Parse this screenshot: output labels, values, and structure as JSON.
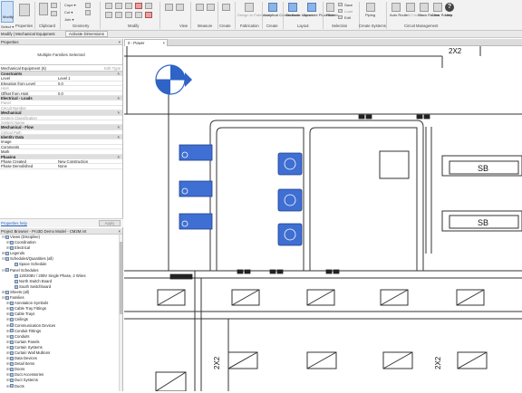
{
  "ribbon": {
    "modify_label": "Modify",
    "select_label": "Select ▾",
    "properties_panel": "Properties",
    "clipboard_panel": "Clipboard",
    "geometry_panel": "Geometry",
    "modify_panel": "Modify",
    "view_panel": "View",
    "measure_panel": "Measure",
    "create_panel": "Create",
    "fabrication_panel": "Fabrication",
    "layout_panel": "Layout",
    "selection_panel": "Selection",
    "create_systems_panel": "Create Systems",
    "circuit_panel": "Circuit Management",
    "cope_label": "Cope ▾",
    "cut_label": "Cut ▾",
    "join_label": "Join ▾",
    "tools": {
      "design_to_fabrication": "Design to Fabrication",
      "analytical_connections": "Analytical Connections",
      "generate_layout": "Generate Layout",
      "generate_placeholder": "Generate Placeholder",
      "filter": "Filter",
      "save": "Save",
      "load": "Load",
      "edit": "Edit",
      "piping": "Piping",
      "auto_route": "Auto Route",
      "edit_circuits": "Edit Circuits",
      "show_routes": "Show Routes",
      "clear_routes": "Clear Routes",
      "help": "Help"
    }
  },
  "context": {
    "title": "Modify | Mechanical Equipment",
    "activate_dimensions": "Activate Dimensions"
  },
  "properties": {
    "title": "Properties",
    "type_selector": "Multiple Families Selected",
    "filter": "Mechanical Equipment (6)",
    "edit_type": "Edit Type",
    "rows": [
      {
        "k": "Constraints",
        "group": true
      },
      {
        "k": "Level",
        "v": "Level 1"
      },
      {
        "k": "Elevation from Level",
        "v": "0.0"
      },
      {
        "k": "Host",
        "v": "",
        "grey": true
      },
      {
        "k": "Offset from Host",
        "v": "0.0"
      },
      {
        "k": "Electrical - Loads",
        "group": true
      },
      {
        "k": "Panel",
        "v": "",
        "grey": true
      },
      {
        "k": "Circuit Number",
        "v": "",
        "grey": true
      },
      {
        "k": "Mechanical",
        "group": true
      },
      {
        "k": "System Classification",
        "v": "",
        "grey": true
      },
      {
        "k": "System Name",
        "v": "",
        "grey": true
      },
      {
        "k": "Mechanical - Flow",
        "group": true
      },
      {
        "k": "Critical Path",
        "v": "",
        "grey": true
      },
      {
        "k": "Identity Data",
        "group": true
      },
      {
        "k": "Image",
        "v": ""
      },
      {
        "k": "Comments",
        "v": ""
      },
      {
        "k": "Mark",
        "v": ""
      },
      {
        "k": "Phasing",
        "group": true
      },
      {
        "k": "Phase Created",
        "v": "New Construction"
      },
      {
        "k": "Phase Demolished",
        "v": "None"
      }
    ],
    "help_link": "Properties help",
    "apply": "Apply"
  },
  "browser": {
    "title": "Project Browser - Pro3D Demo Model - CM2M.rvt",
    "items": [
      {
        "ex": "⊟",
        "label": "Views (Discipline)",
        "indent": 0
      },
      {
        "ex": "⊞",
        "label": "Coordination",
        "indent": 1
      },
      {
        "ex": "⊞",
        "label": "Electrical",
        "indent": 1
      },
      {
        "ex": "⊞",
        "label": "Legends",
        "indent": 0
      },
      {
        "ex": "⊟",
        "label": "Schedules/Quantities (all)",
        "indent": 0
      },
      {
        "ex": "",
        "label": "Space Schedule",
        "indent": 2
      },
      {
        "ex": "⊟",
        "label": "Panel Schedules",
        "indent": 0
      },
      {
        "ex": "",
        "label": "120/208V / 208V Single Phase, 2 Wires",
        "indent": 2
      },
      {
        "ex": "",
        "label": "North Switch Board",
        "indent": 2
      },
      {
        "ex": "",
        "label": "South Switchboard",
        "indent": 2
      },
      {
        "ex": "⊞",
        "label": "Sheets (all)",
        "indent": 0
      },
      {
        "ex": "⊟",
        "label": "Families",
        "indent": 0
      },
      {
        "ex": "⊞",
        "label": "Annotation Symbols",
        "indent": 1
      },
      {
        "ex": "⊞",
        "label": "Cable Tray Fittings",
        "indent": 1
      },
      {
        "ex": "⊞",
        "label": "Cable Trays",
        "indent": 1
      },
      {
        "ex": "⊞",
        "label": "Ceilings",
        "indent": 1
      },
      {
        "ex": "⊞",
        "label": "Communication Devices",
        "indent": 1
      },
      {
        "ex": "⊞",
        "label": "Conduit Fittings",
        "indent": 1
      },
      {
        "ex": "⊞",
        "label": "Conduits",
        "indent": 1
      },
      {
        "ex": "⊞",
        "label": "Curtain Panels",
        "indent": 1
      },
      {
        "ex": "⊞",
        "label": "Curtain Systems",
        "indent": 1
      },
      {
        "ex": "⊞",
        "label": "Curtain Wall Mullions",
        "indent": 1
      },
      {
        "ex": "⊞",
        "label": "Data Devices",
        "indent": 1
      },
      {
        "ex": "⊞",
        "label": "Detail Items",
        "indent": 1
      },
      {
        "ex": "⊞",
        "label": "Doors",
        "indent": 1
      },
      {
        "ex": "⊞",
        "label": "Duct Accessories",
        "indent": 1
      },
      {
        "ex": "⊞",
        "label": "Duct Systems",
        "indent": 1
      },
      {
        "ex": "⊞",
        "label": "Ducts",
        "indent": 1
      }
    ]
  },
  "view": {
    "tab_label": "0 - Power",
    "sb_label_1": "SB",
    "sb_label_2": "SB",
    "tag_top_right": "2X2",
    "tag_bottom_left_1": "2X2",
    "tag_bottom_left_2": "2X2",
    "accent_blue": "#2f63c6",
    "equip_blue": "#3f6fd2"
  }
}
